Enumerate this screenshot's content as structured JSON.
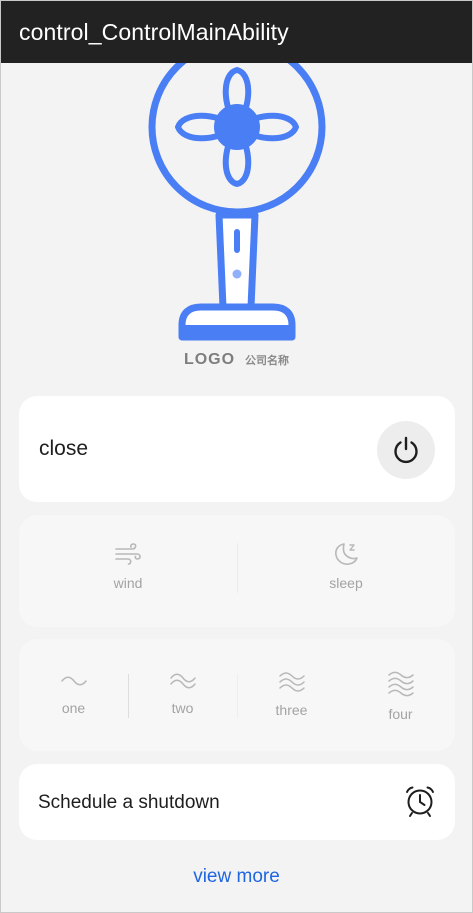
{
  "window": {
    "title": "control_ControlMainAbility"
  },
  "device": {
    "logo_text": "LOGO",
    "company_text": "公司名称",
    "fan_icon": "standing-fan-illustration"
  },
  "power": {
    "label": "close",
    "icon": "power-icon"
  },
  "modes": [
    {
      "label": "wind",
      "icon": "wind-icon"
    },
    {
      "label": "sleep",
      "icon": "moon-sleep-icon"
    }
  ],
  "speeds": [
    {
      "label": "one",
      "icon": "wave-1-icon"
    },
    {
      "label": "two",
      "icon": "wave-2-icon"
    },
    {
      "label": "three",
      "icon": "wave-3-icon"
    },
    {
      "label": "four",
      "icon": "wave-4-icon"
    }
  ],
  "schedule": {
    "label": "Schedule a shutdown",
    "icon": "alarm-clock-icon"
  },
  "footer": {
    "view_more": "view more"
  },
  "colors": {
    "accent": "#4a7ef5",
    "link": "#1f66e0",
    "titlebar": "#222222",
    "background": "#f3f3f3"
  }
}
